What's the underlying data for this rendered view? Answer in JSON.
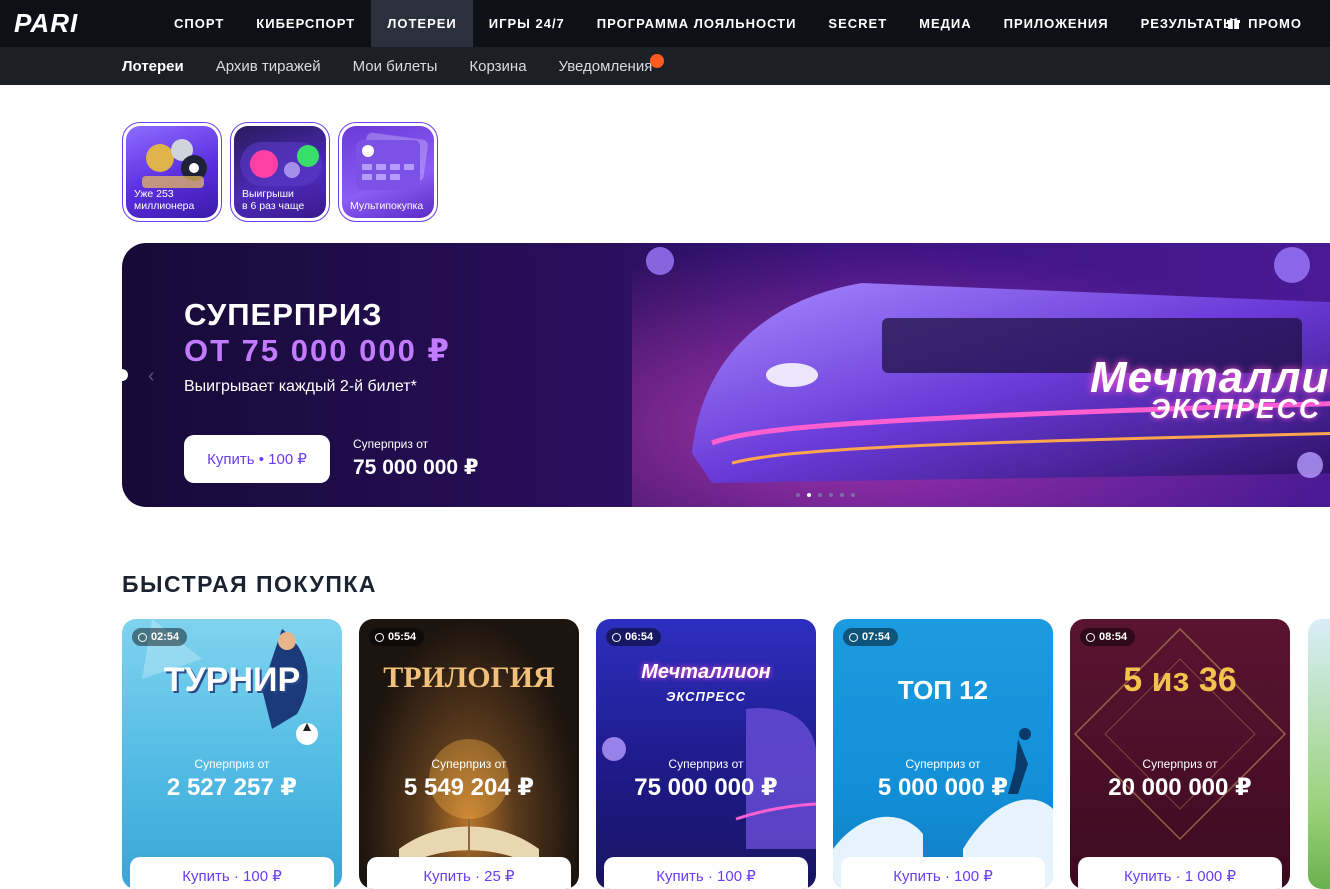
{
  "header": {
    "logo_text": "PARI",
    "nav": [
      "СПОРТ",
      "КИБЕРСПОРТ",
      "ЛОТЕРЕИ",
      "ИГРЫ 24/7",
      "ПРОГРАММА ЛОЯЛЬНОСТИ",
      "SECRET",
      "МЕДИА",
      "ПРИЛОЖЕНИЯ",
      "РЕЗУЛЬТАТЫ"
    ],
    "active_nav": "ЛОТЕРЕИ",
    "promo_label": "ПРОМО",
    "promo_icon": "gift-icon"
  },
  "subnav": {
    "items": [
      "Лотереи",
      "Архив тиражей",
      "Мои билеты",
      "Корзина",
      "Уведомления"
    ],
    "active": "Лотереи",
    "notification_color": "#ff5a1f"
  },
  "stories": [
    {
      "label_line1": "Уже 253",
      "label_line2": "миллионера"
    },
    {
      "label_line1": "Выигрыши",
      "label_line2": "в 6 раз чаще"
    },
    {
      "label_line1": "Мультипокупка",
      "label_line2": ""
    }
  ],
  "banner": {
    "title_line1": "СУПЕРПРИЗ",
    "title_line2": "ОТ 75 000 000 ₽",
    "subtitle": "Выигрывает каждый 2-й билет*",
    "buy_label": "Купить • 100 ₽",
    "prize_label": "Суперприз от",
    "prize_value": "75 000 000 ₽",
    "lottery_logo_line1": "Мечталлион",
    "lottery_logo_line2": "ЭКСПРЕСС",
    "slides_count": 6,
    "active_slide": 2,
    "accent_color": "#c27bff"
  },
  "quick_buy": {
    "title": "БЫСТРАЯ ПОКУПКА",
    "cards": [
      {
        "timer": "02:54",
        "logo": "ТУРНИР",
        "prize_label": "Суперприз от",
        "prize": "2 527 257 ₽",
        "buy": "Купить · 100 ₽"
      },
      {
        "timer": "05:54",
        "logo": "ТРИЛОГИЯ",
        "prize_label": "Суперприз от",
        "prize": "5 549 204 ₽",
        "buy": "Купить · 25 ₽"
      },
      {
        "timer": "06:54",
        "logo": "Мечталлион",
        "logo_sub": "ЭКСПРЕСС",
        "prize_label": "Суперприз от",
        "prize": "75 000 000 ₽",
        "buy": "Купить · 100 ₽"
      },
      {
        "timer": "07:54",
        "logo": "ТОП 12",
        "prize_label": "Суперприз от",
        "prize": "5 000 000 ₽",
        "buy": "Купить · 100 ₽"
      },
      {
        "timer": "08:54",
        "logo": "5 из 36",
        "prize_label": "Суперприз от",
        "prize": "20 000 000 ₽",
        "buy": "Купить · 1 000 ₽"
      }
    ]
  },
  "colors": {
    "nav_bg": "#0d1117",
    "subnav_bg": "#1c2026",
    "brand_purple": "#6a3df5"
  }
}
